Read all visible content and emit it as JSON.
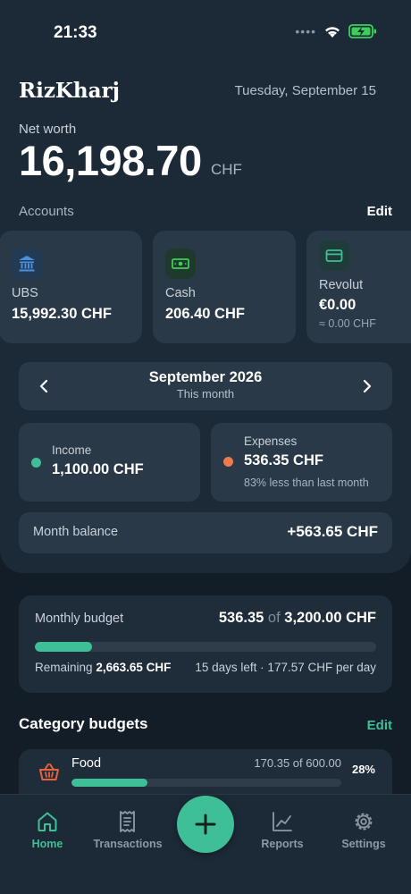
{
  "status_bar": {
    "time": "21:33"
  },
  "header": {
    "app_name": "RizKharj",
    "date": "Tuesday, September 15",
    "net_worth_label": "Net worth",
    "net_worth_value": "16,198.70",
    "net_worth_currency": "CHF"
  },
  "accounts": {
    "label": "Accounts",
    "edit_label": "Edit",
    "items": [
      {
        "name": "UBS",
        "amount": "15,992.30 CHF",
        "sub": "",
        "icon": "bank-icon",
        "icon_color": "#4a8fe0",
        "icon_bg": "#233a55"
      },
      {
        "name": "Cash",
        "amount": "206.40 CHF",
        "sub": "",
        "icon": "cash-icon",
        "icon_color": "#3ccf5a",
        "icon_bg": "#1f3a2c"
      },
      {
        "name": "Revolut",
        "amount": "€0.00",
        "sub": "≈ 0.00 CHF",
        "icon": "card-icon",
        "icon_color": "#3fbf97",
        "icon_bg": "#1f3b3a"
      }
    ]
  },
  "month": {
    "title": "September 2026",
    "subtitle": "This month",
    "income": {
      "label": "Income",
      "value": "1,100.00 CHF",
      "color": "#3fbf97"
    },
    "expenses": {
      "label": "Expenses",
      "value": "536.35 CHF",
      "note": "83% less than last month",
      "color": "#f07a50"
    },
    "balance_label": "Month balance",
    "balance_value": "+563.65 CHF"
  },
  "budget": {
    "title": "Monthly budget",
    "spent": "536.35",
    "of": "of",
    "total": "3,200.00 CHF",
    "progress": 0.168,
    "remaining_label": "Remaining",
    "remaining_value": "2,663.65 CHF",
    "days_info": "15 days left · 177.57 CHF per day"
  },
  "category_budgets": {
    "title": "Category budgets",
    "edit_label": "Edit",
    "items": [
      {
        "name": "Food",
        "amounts": "170.35 of 600.00",
        "percent": "28%",
        "progress": 0.28,
        "icon": "basket-icon",
        "icon_color": "#e8623c"
      }
    ]
  },
  "nav": {
    "items": [
      {
        "label": "Home",
        "icon": "home-icon",
        "active": true
      },
      {
        "label": "Transactions",
        "icon": "receipt-icon",
        "active": false
      },
      {
        "label": "Reports",
        "icon": "chart-icon",
        "active": false
      },
      {
        "label": "Settings",
        "icon": "gear-icon",
        "active": false
      }
    ],
    "add_icon": "plus-icon"
  },
  "colors": {
    "accent": "#3fbf97",
    "background": "#131d27",
    "panel": "#1c2a38",
    "card": "#2a3947"
  }
}
